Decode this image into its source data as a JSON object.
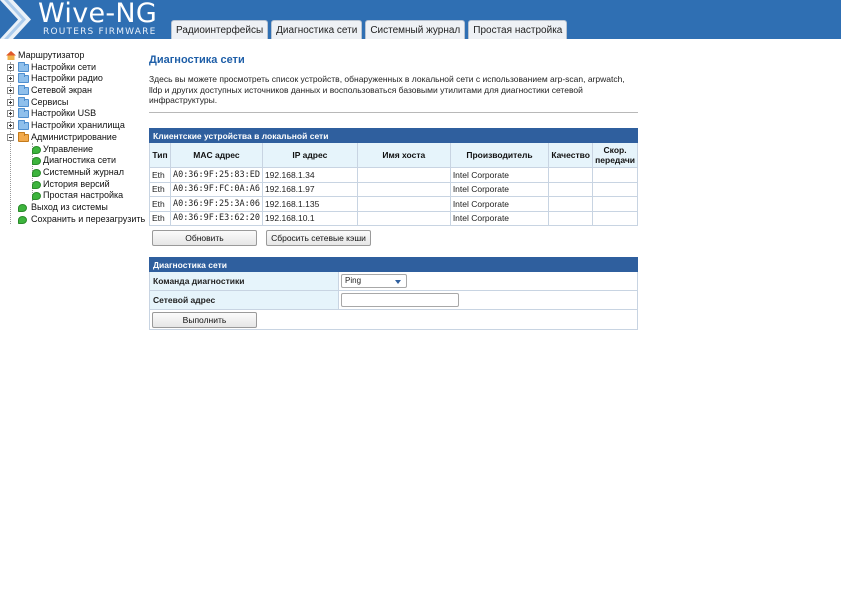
{
  "header": {
    "logo_title": "Wive-NG",
    "logo_subtitle": "ROUTERS FIRMWARE",
    "tabs": [
      "Радиоинтерфейсы",
      "Диагностика сети",
      "Системный журнал",
      "Простая настройка"
    ]
  },
  "sidebar": {
    "root": "Маршрутизатор",
    "groups": [
      "Настройки сети",
      "Настройки радио",
      "Сетевой экран",
      "Сервисы",
      "Настройки USB",
      "Настройки хранилища",
      "Администрирование"
    ],
    "admin_items": [
      "Управление",
      "Диагностика сети",
      "Системный журнал",
      "История версий",
      "Простая настройка"
    ],
    "bottom_items": [
      "Выход из системы",
      "Сохранить и перезагрузить"
    ]
  },
  "main": {
    "title": "Диагностика сети",
    "intro": "Здесь вы можете просмотреть список устройств, обнаруженных в локальной сети с использованием arp-scan, arpwatch, lldp и других доступных источников данных и воспользоваться базовыми утилитами для диагностики сетевой инфраструктуры."
  },
  "devices": {
    "caption": "Клиентские устройства в локальной сети",
    "columns": [
      "Тип",
      "MAC адрес",
      "IP адрес",
      "Имя хоста",
      "Производитель",
      "Качество",
      "Скор. передачи"
    ],
    "rows": [
      [
        "Eth",
        "A0:36:9F:25:83:ED",
        "192.168.1.34",
        "",
        "Intel Corporate",
        "",
        ""
      ],
      [
        "Eth",
        "A0:36:9F:FC:0A:A6",
        "192.168.1.97",
        "",
        "Intel Corporate",
        "",
        ""
      ],
      [
        "Eth",
        "A0:36:9F:25:3A:06",
        "192.168.1.135",
        "",
        "Intel Corporate",
        "",
        ""
      ],
      [
        "Eth",
        "A0:36:9F:E3:62:20",
        "192.168.10.1",
        "",
        "Intel Corporate",
        "",
        ""
      ]
    ],
    "refresh_label": "Обновить",
    "flush_label": "Сбросить сетевые кэши"
  },
  "diagnostics": {
    "caption": "Диагностика сети",
    "command_label": "Команда диагностики",
    "command_value": "Ping",
    "address_label": "Сетевой адрес",
    "address_value": "",
    "run_label": "Выполнить"
  },
  "colors": {
    "header_bg": "#2f6fb3",
    "caption_bg": "#2f5f9e",
    "title_blue": "#1f5fa8",
    "label_cell_bg": "#e6f4fb"
  }
}
